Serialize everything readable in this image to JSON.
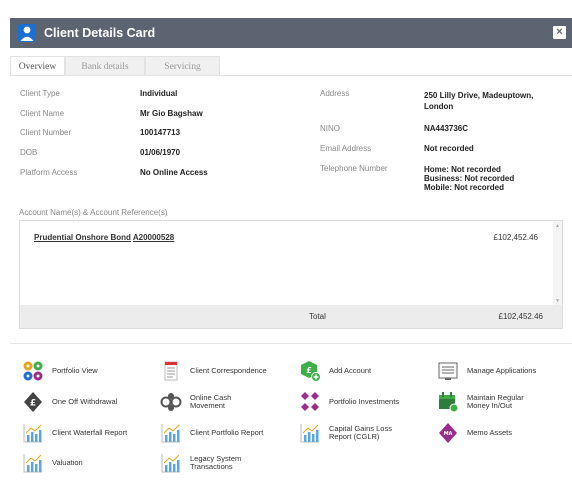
{
  "window": {
    "title": "Client Details Card",
    "close_label": "×"
  },
  "tabs": [
    {
      "label": "Overview",
      "active": true
    },
    {
      "label": "Bank details",
      "active": false
    },
    {
      "label": "Servicing",
      "active": false
    }
  ],
  "details_left": [
    {
      "label": "Client Type",
      "value": "Individual"
    },
    {
      "label": "Client Name",
      "value": "Mr Gio Bagshaw"
    },
    {
      "label": "Client Number",
      "value": "100147713"
    },
    {
      "label": "DOB",
      "value": "01/06/1970"
    },
    {
      "label": "Platform Access",
      "value": "No Online Access"
    }
  ],
  "details_right": [
    {
      "label": "Address",
      "value_lines": [
        "250 Lilly Drive, Madeuptown,",
        "London"
      ]
    },
    {
      "label": "NINO",
      "value_lines": [
        "NA443736C"
      ]
    },
    {
      "label": "Email Address",
      "value_lines": [
        "Not recorded"
      ]
    },
    {
      "label": "Telephone Number",
      "value_lines": [
        "Home: Not recorded",
        "Business: Not recorded",
        "Mobile: Not recorded"
      ]
    }
  ],
  "accounts": {
    "heading": "Account Name(s) & Account Reference(s)",
    "rows": [
      {
        "name": "Prudential Onshore Bond",
        "reference": "A20000528",
        "amount": "£102,452.46"
      }
    ],
    "total_label": "Total",
    "total_value": "£102,452.46"
  },
  "actions": [
    {
      "label": "Portfolio View",
      "icon": "portfolio-view-icon"
    },
    {
      "label": "Client Correspondence",
      "icon": "correspondence-icon"
    },
    {
      "label": "Add Account",
      "icon": "add-account-icon"
    },
    {
      "label": "Manage Applications",
      "icon": "manage-applications-icon"
    },
    {
      "label": "One Off Withdrawal",
      "icon": "withdrawal-icon"
    },
    {
      "label": "Online Cash Movement",
      "icon": "cash-movement-icon"
    },
    {
      "label": "Portfolio Investments",
      "icon": "portfolio-investments-icon"
    },
    {
      "label": "Maintain Regular Money In/Out",
      "icon": "regular-money-icon"
    },
    {
      "label": "Client Waterfall Report",
      "icon": "report-chart-icon"
    },
    {
      "label": "Client Portfolio Report",
      "icon": "report-chart-icon"
    },
    {
      "label": "Capital Gains Loss Report (CGLR)",
      "icon": "report-chart-icon"
    },
    {
      "label": "Memo Assets",
      "icon": "memo-assets-icon"
    },
    {
      "label": "Valuation",
      "icon": "report-chart-icon"
    },
    {
      "label": "Legacy System Transactions",
      "icon": "report-chart-icon"
    }
  ],
  "colors": {
    "titlebar": "#5b6470",
    "accent": "#1a6fd1",
    "green": "#3fae49",
    "purple": "#9b2c8c"
  }
}
